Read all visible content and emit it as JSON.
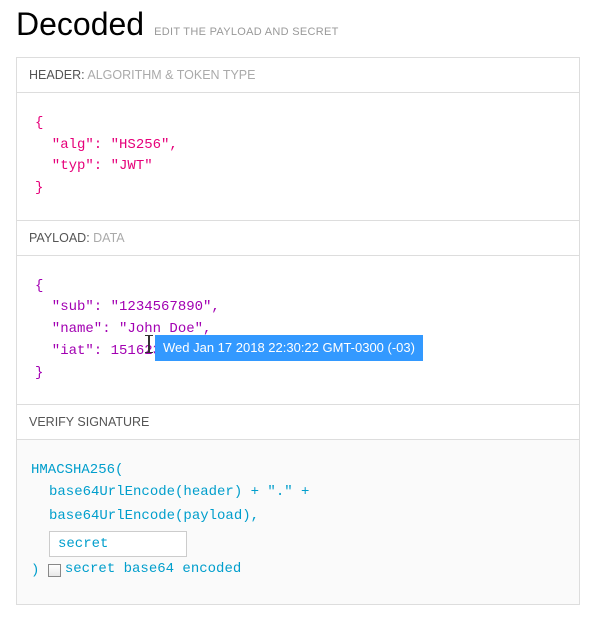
{
  "title": "Decoded",
  "subtitle": "EDIT THE PAYLOAD AND SECRET",
  "sections": {
    "header": {
      "label": "HEADER:",
      "sub": "ALGORITHM & TOKEN TYPE"
    },
    "payload": {
      "label": "PAYLOAD:",
      "sub": "DATA"
    },
    "signature": {
      "label": "VERIFY SIGNATURE",
      "sub": ""
    }
  },
  "header_json": "{\n  \"alg\": \"HS256\",\n  \"typ\": \"JWT\"\n}",
  "payload_json": "{\n  \"sub\": \"1234567890\",\n  \"name\": \"John Doe\",\n  \"iat\": 1516239022\n}",
  "tooltip": "Wed Jan 17 2018 22:30:22 GMT-0300 (-03)",
  "signature": {
    "fn": "HMACSHA256(",
    "line1": "base64UrlEncode(header) + \".\" +",
    "line2": "base64UrlEncode(payload),",
    "secret_value": "secret",
    "secret_placeholder": "secret",
    "close": ")",
    "checkbox_label": "secret base64 encoded",
    "checkbox_checked": false
  }
}
